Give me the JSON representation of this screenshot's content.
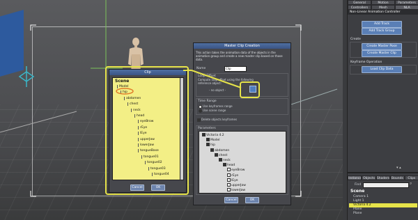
{
  "right_panel": {
    "tabs_row1": [
      "General",
      "Motion",
      "Parameters"
    ],
    "tabs_row2": [
      "Controllers",
      "Mesh",
      "NLA"
    ],
    "panel_title": "Non-Linear Animation Controller",
    "add_track": "Add Track",
    "add_track_group": "Add Track Group",
    "create_label": "Create",
    "create_master_pose": "Create Master Pose",
    "create_master_clip": "Create Master Clip",
    "keyframe_label": "Keyframe Operation",
    "load_clip_data": "Load Clip Data",
    "bottom_tabs": [
      "Instances",
      "Objects",
      "Shaders",
      "Bounds",
      "Clips"
    ],
    "find_label": "Find",
    "scene_title": "Scene",
    "scene_items": [
      "Camera 1",
      "Light 1",
      "Victoria 4.2",
      "Plane",
      "Plane"
    ]
  },
  "master_dialog": {
    "title": "Master Clip Creation",
    "description": "This action takes the animation data of the objects in the animation group and create a new master clip based on those data.",
    "name_label": "Name",
    "name_value": "Clip",
    "loop_offset_label": "Loop Offset",
    "loop_offset_text": "Compute loop offset using the following reference object:",
    "no_object": "- no object -",
    "time_range_label": "Time Range",
    "use_keyframes": "Use keyframes range",
    "use_scene": "Use scene range",
    "delete_keyframes": "Delete objects keyframes",
    "parameters_label": "Parameters",
    "param_items": [
      "Victoria 4.2",
      "Model",
      "hip",
      "abdomen",
      "chest",
      "neck",
      "head",
      "eyeBrow",
      "rEye",
      "lEye",
      "upperJaw",
      "lowerJaw"
    ],
    "cancel": "Cancel",
    "ok": "OK"
  },
  "clip_dialog": {
    "title": "Clip",
    "scene_label": "Scene",
    "tree_items": [
      "Model",
      "hip",
      "abdomen",
      "chest",
      "neck",
      "head",
      "eyeBrow",
      "rEye",
      "lEye",
      "upperJaw",
      "lowerJaw",
      "tongueBase",
      "tongue01",
      "tongue02",
      "tongue03",
      "tongue04"
    ],
    "cancel": "Cancel",
    "ok": "OK"
  },
  "colors": {
    "highlight_yellow": "#e6e34a",
    "selection_orange": "#e07b2a",
    "list_yellow": "#f3ef86",
    "button_blue": "#5a7fb6"
  }
}
